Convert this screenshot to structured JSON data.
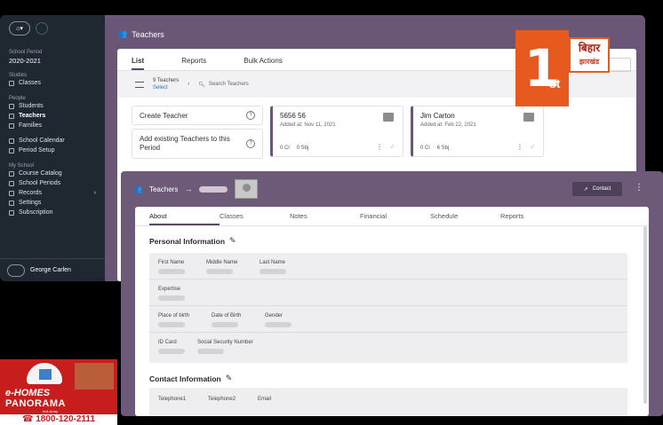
{
  "sidebar": {
    "school_period_label": "School Period",
    "school_period_value": "2020-2021",
    "studies_label": "Studies",
    "items_studies": [
      "Classes"
    ],
    "people_label": "People",
    "items_people": [
      "Students",
      "Teachers",
      "Families"
    ],
    "items_misc": [
      "School Calendar",
      "Period Setup"
    ],
    "myschool_label": "My School",
    "items_myschool": [
      "Course Catalog",
      "School Periods",
      "Records",
      "Settings",
      "Subscription"
    ],
    "user_name": "George Carlen"
  },
  "back": {
    "title": "Teachers",
    "tabs": [
      "List",
      "Reports",
      "Bulk Actions"
    ],
    "teacher_count": "9 Teachers",
    "select_label": "Select",
    "search_placeholder": "Search Teachers",
    "create_teacher": "Create Teacher",
    "add_existing": "Add existing Teachers to this Period",
    "cards": [
      {
        "name": "5656 56",
        "added": "Added at: Nov 11, 2021",
        "classes": "0 Cl",
        "subjects": "0 Sbj"
      },
      {
        "name": "Jim Carton",
        "added": "Added at: Feb 22, 2021",
        "classes": "0 Cl",
        "subjects": "6 Sbj"
      }
    ]
  },
  "front": {
    "breadcrumb_root": "Teachers",
    "breadcrumb_sep": "→",
    "contact_button": "Contact",
    "tabs": [
      "About",
      "Classes",
      "Notes",
      "Financial",
      "Schedule",
      "Reports"
    ],
    "personal_title": "Personal Information",
    "fields_row1": [
      "First Name",
      "Middle Name",
      "Last Name"
    ],
    "fields_row2": [
      "Expertise"
    ],
    "fields_row3": [
      "Place of birth",
      "Date of Birth",
      "Gender"
    ],
    "fields_row4": [
      "ID Card",
      "Social Security Number"
    ],
    "contact_title": "Contact Information",
    "fields_contact": [
      "Telephone1",
      "Telephone2",
      "Email"
    ]
  },
  "logo": {
    "num": "1",
    "suffix": "st",
    "line1": "बिहार",
    "line2": "झारखंड"
  },
  "ad": {
    "line1": "e-HOMES",
    "line2": "PANORAMA",
    "tag": "Indi-Army",
    "phone": "1800-120-2111"
  },
  "colors": {
    "accent": "#6a5777",
    "sidebar": "#1f2731",
    "logo_orange": "#e75a1f",
    "ad_red": "#c71d1d"
  }
}
